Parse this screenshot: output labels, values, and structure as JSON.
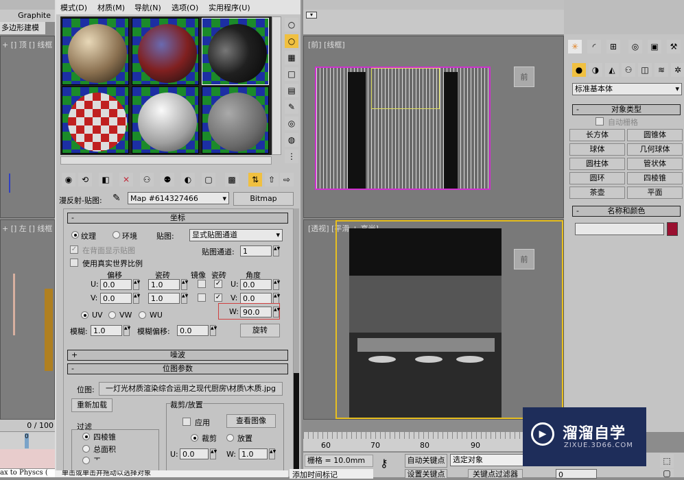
{
  "left_strip": {
    "ribbon_label": "Graphite",
    "ribbon_tab": "多边形建模",
    "viewport_top_label": "+ [] 顶 [] 线框",
    "viewport_left_label": "+ [] 左 [] 线框",
    "time_slider": "0 / 100",
    "frame": "0",
    "status_text": "ax to Physcs ("
  },
  "material_editor": {
    "menu": [
      "模式(D)",
      "材质(M)",
      "导航(N)",
      "选项(O)",
      "实用程序(U)"
    ],
    "map_label": "漫反射-贴图:",
    "map_name": "Map #614327466",
    "map_type": "Bitmap",
    "coords": {
      "title": "坐标",
      "texture": "纹理",
      "environ": "环境",
      "mapping_label": "贴图:",
      "mapping_value": "显式贴图通道",
      "show_back": "在背面显示贴图",
      "map_channel_label": "贴图通道:",
      "map_channel": "1",
      "real_world": "使用真实世界比例",
      "h_offset": "偏移",
      "h_tiling": "瓷砖",
      "h_mirror": "镜像",
      "h_tile": "瓷砖",
      "h_angle": "角度",
      "u_label": "U:",
      "v_label": "V:",
      "w_label": "W:",
      "u_offset": "0.0",
      "v_offset": "0.0",
      "u_tiling": "1.0",
      "v_tiling": "1.0",
      "u_angle": "0.0",
      "v_angle": "0.0",
      "w_angle": "90.0",
      "uv": "UV",
      "vw": "VW",
      "wu": "WU",
      "blur_label": "模糊:",
      "blur": "1.0",
      "blur_offset_label": "模糊偏移:",
      "blur_offset": "0.0",
      "rotate": "旋转"
    },
    "noise_title": "噪波",
    "bitmap": {
      "title": "位图参数",
      "bitmap_label": "位图:",
      "path": "一灯光材质渲染综合运用之现代厨房\\材质\\木质.jpg",
      "reload": "重新加载",
      "filter_label": "过滤",
      "filter_pyramidal": "四棱锥",
      "filter_sat": "总面积",
      "filter_none": "无",
      "crop_label": "裁剪/放置",
      "apply": "应用",
      "view_image": "查看图像",
      "crop": "裁剪",
      "place": "放置",
      "u_value": "0.0",
      "w_value": "1.0"
    }
  },
  "viewports": {
    "front_label": "[前] [线框]",
    "persp_label": "[透视] [平滑 + 高光]",
    "viewcube_label": "前"
  },
  "command_panel": {
    "dropdown": "标准基本体",
    "object_type": "对象类型",
    "autogrid": "自动栅格",
    "buttons": [
      "长方体",
      "圆锥体",
      "球体",
      "几何球体",
      "圆柱体",
      "管状体",
      "圆环",
      "四棱锥",
      "茶壶",
      "平面"
    ],
    "name_color": "名称和颜色",
    "object_color": "#9a1030"
  },
  "timeline": {
    "ticks": [
      "60",
      "70",
      "80",
      "90"
    ]
  },
  "status": {
    "grid": "栅格 = 10.0mm",
    "auto_key": "自动关键点",
    "selected": "选定对象",
    "set_key": "设置关键点",
    "key_filters": "关键点过滤器",
    "add_tag": "添加时间标记",
    "prompt": "单击或单击并拖动以选择对象",
    "frame_value": "0"
  },
  "watermark": {
    "name": "溜溜自学",
    "url": "ZIXUE.3D66.COM"
  }
}
